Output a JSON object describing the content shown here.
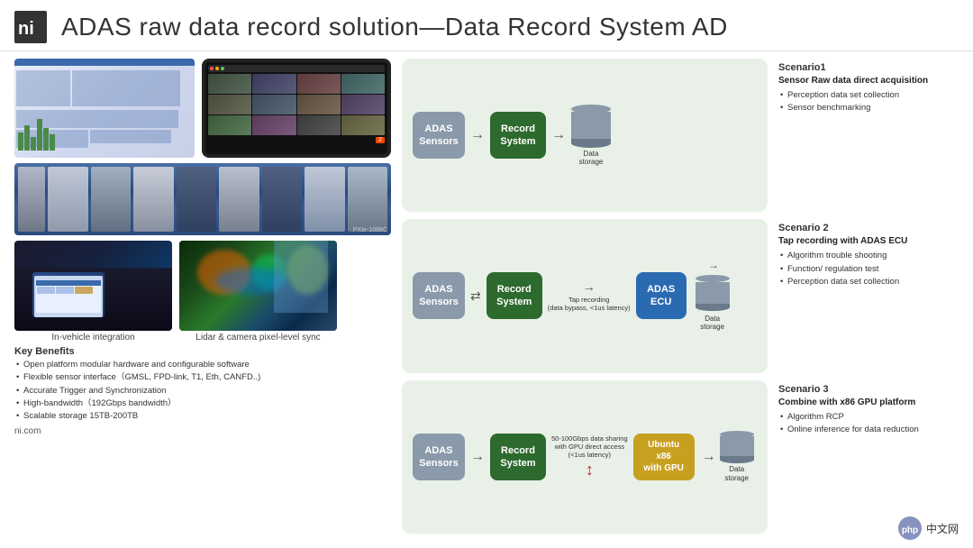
{
  "header": {
    "title": "ADAS raw data record solution—Data Record System AD",
    "logo_alt": "NI Logo"
  },
  "left": {
    "caption1": "In-vehicle  integration",
    "caption2": "Lidar & camera pixel-level sync",
    "pxi_label": "PXIe-1088C",
    "key_benefits": {
      "title": "Key Benefits",
      "items": [
        "Open platform modular hardware and configurable software",
        "Flexible sensor interface（GMSL, FPD-link, T1, Eth, CANFD..)",
        "Accurate Trigger and Synchronization",
        "High-bandwidth（192Gbps bandwidth）",
        "Scalable storage 15TB-200TB"
      ]
    },
    "website": "ni.com"
  },
  "scenarios": {
    "s1": {
      "label": "Scenario1",
      "subtitle": "Sensor Raw data direct acquisition",
      "items": [
        "Perception data set collection",
        "Sensor benchmarking"
      ],
      "nodes": {
        "adas": "ADAS\nSensors",
        "record": "Record\nSystem",
        "storage": "Data\nstorage"
      }
    },
    "s2": {
      "label": "Scenario 2",
      "subtitle": "Tap recording  with ADAS ECU",
      "items": [
        "Algorithm trouble shooting",
        "Function/ regulation test",
        "Perception data set collection"
      ],
      "nodes": {
        "adas": "ADAS\nSensors",
        "record": "Record\nSystem",
        "ecu": "ADAS\nECU",
        "storage": "Data\nstorage"
      },
      "tap_label": "Tap recording\n(data bypass, <1us latency)"
    },
    "s3": {
      "label": "Scenario 3",
      "subtitle": "Combine with x86 GPU platform",
      "items": [
        "Algorithm RCP",
        "Online inference for data reduction"
      ],
      "nodes": {
        "adas": "ADAS\nSensors",
        "record": "Record\nSystem",
        "ubuntu": "Ubuntu x86\nwith GPU",
        "storage": "Data\nstorage"
      },
      "sharing_label": "50-100Gbps data sharing\nwith GPU direct access\n(<1us latency)"
    }
  },
  "footer": {
    "php_label": "php",
    "chinese_label": "中文网"
  }
}
